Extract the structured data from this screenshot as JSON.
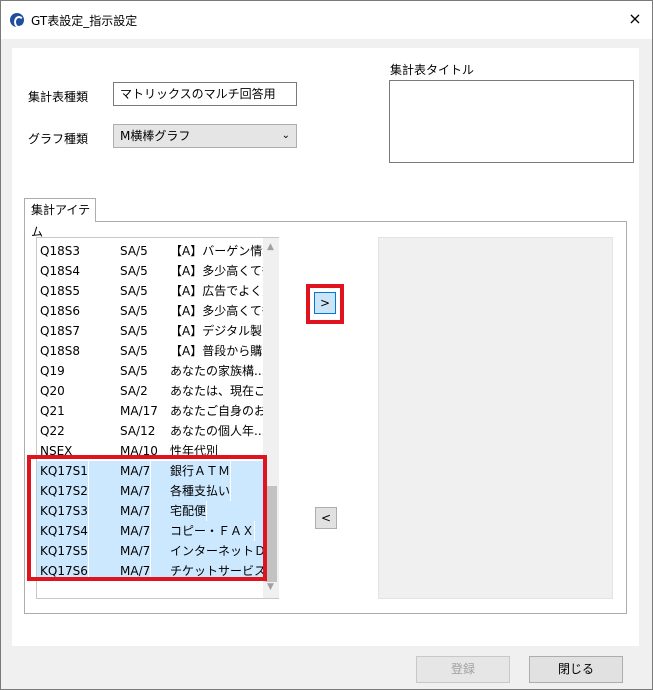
{
  "window": {
    "title": "GT表設定_指示設定",
    "close_label": "×"
  },
  "form": {
    "table_type_label": "集計表種類",
    "table_type_value": "マトリックスのマルチ回答用",
    "graph_type_label": "グラフ種類",
    "graph_type_value": "M横棒グラフ",
    "title_label": "集計表タイトル",
    "title_value": ""
  },
  "tab": {
    "label": "集計アイテム"
  },
  "list": {
    "rows": [
      {
        "id": "Q18S3",
        "type": "SA/5",
        "text": "【A】バーゲン情報..."
      },
      {
        "id": "Q18S4",
        "type": "SA/5",
        "text": "【A】多少高くても..."
      },
      {
        "id": "Q18S5",
        "type": "SA/5",
        "text": "【A】広告でよく見..."
      },
      {
        "id": "Q18S6",
        "type": "SA/5",
        "text": "【A】多少高くても..."
      },
      {
        "id": "Q18S7",
        "type": "SA/5",
        "text": "【A】デジタル製品..."
      },
      {
        "id": "Q18S8",
        "type": "SA/5",
        "text": "【A】普段から購..."
      },
      {
        "id": "Q19",
        "type": "SA/5",
        "text": "あなたの家族構..."
      },
      {
        "id": "Q20",
        "type": "SA/2",
        "text": "あなたは、現在ご..."
      },
      {
        "id": "Q21",
        "type": "MA/17",
        "text": "あなたご自身のお..."
      },
      {
        "id": "Q22",
        "type": "SA/12",
        "text": "あなたの個人年..."
      },
      {
        "id": "NSEX",
        "type": "MA/10",
        "text": "性年代別"
      },
      {
        "id": "KQ17S1",
        "type": "MA/7",
        "text": "銀行ＡＴＭ"
      },
      {
        "id": "KQ17S2",
        "type": "MA/7",
        "text": "各種支払い"
      },
      {
        "id": "KQ17S3",
        "type": "MA/7",
        "text": "宅配便"
      },
      {
        "id": "KQ17S4",
        "type": "MA/7",
        "text": "コピー・ＦＡＸ"
      },
      {
        "id": "KQ17S5",
        "type": "MA/7",
        "text": "インターネットＤＰ..."
      },
      {
        "id": "KQ17S6",
        "type": "MA/7",
        "text": "チケットサービス"
      }
    ],
    "selected_from_index": 11
  },
  "buttons": {
    "add_label": ">",
    "remove_label": "<",
    "register_label": "登録",
    "close_label": "閉じる"
  },
  "colors": {
    "highlight": "#e0141e",
    "selected_row": "#cce8ff"
  }
}
